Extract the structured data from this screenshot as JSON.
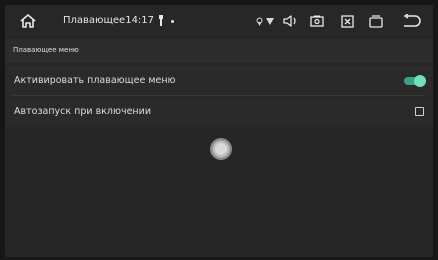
{
  "statusbar": {
    "home_icon": "home-icon",
    "app_title": "Плавающее14:17",
    "icons": [
      "usb-icon",
      "location-icon",
      "wifi-icon",
      "volume-icon",
      "screenshot-icon",
      "close-box-icon",
      "window-icon",
      "back-icon"
    ]
  },
  "header": {
    "title": "Плавающее меню"
  },
  "settings": {
    "items": [
      {
        "label": "Активировать плавающее меню",
        "control": "toggle",
        "value": true
      },
      {
        "label": "Автозапуск при включении",
        "control": "checkbox",
        "value": false
      }
    ]
  },
  "colors": {
    "background": "#262626",
    "toggle_on": "#6fe0c2",
    "toggle_track": "#3f9f86"
  }
}
